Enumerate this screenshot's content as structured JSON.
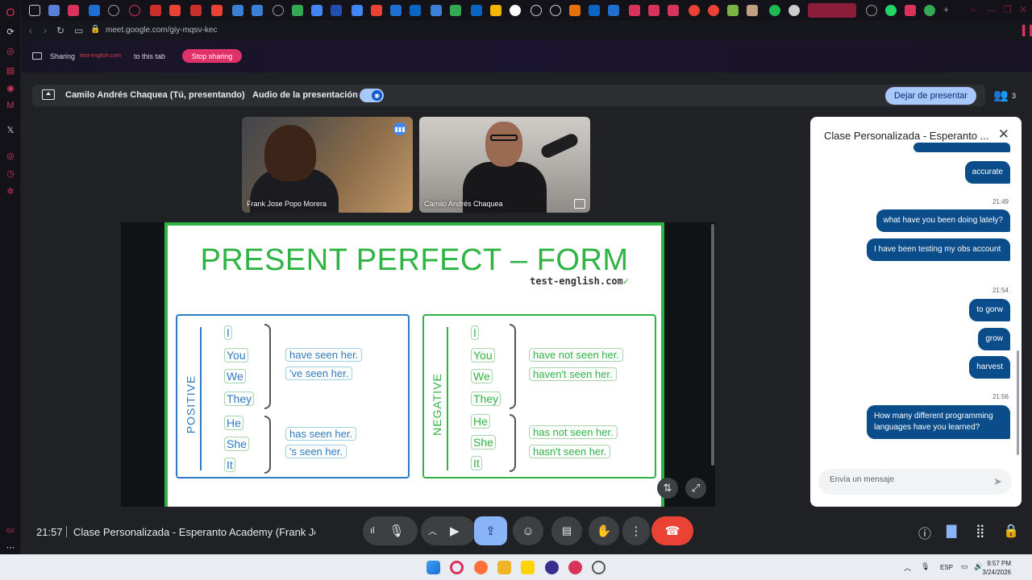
{
  "browser": {
    "url": "meet.google.com/giy-mqsv-kec"
  },
  "share_bar": {
    "sharing_label": "Sharing",
    "domain": "test-english.com",
    "to_tab": "to this tab",
    "stop_label": "Stop sharing"
  },
  "present_bar": {
    "presenter": "Camilo Andrés Chaquea (Tú, presentando)",
    "audio_label": "Audio de la presentación",
    "stop_presenting": "Dejar de presentar",
    "participant_count": "3"
  },
  "tiles": [
    {
      "name": "Frank Jose Popo Morera"
    },
    {
      "name": "Camilo Andrés Chaquea"
    }
  ],
  "slide": {
    "title": "PRESENT PERFECT – FORM",
    "brand": "test-english.com",
    "positive": {
      "label": "POSITIVE",
      "pronouns_a": [
        "I",
        "You",
        "We",
        "They"
      ],
      "pronouns_b": [
        "He",
        "She",
        "It"
      ],
      "verbs_a": [
        "have seen her.",
        "'ve seen her."
      ],
      "verbs_b": [
        "has seen her.",
        "'s seen her."
      ]
    },
    "negative": {
      "label": "NEGATIVE",
      "pronouns_a": [
        "I",
        "You",
        "We",
        "They"
      ],
      "pronouns_b": [
        "He",
        "She",
        "It"
      ],
      "verbs_a": [
        "have not seen her.",
        "haven't seen her."
      ],
      "verbs_b": [
        "has not seen her.",
        "hasn't seen her."
      ]
    },
    "accent_green": "#2fb343",
    "accent_blue": "#2f7ac0"
  },
  "chat": {
    "title": "Clase Personalizada - Esperanto ...",
    "messages": [
      {
        "time": "",
        "text": "accurate"
      },
      {
        "time": "21:49",
        "text": "what have you been doing lately?"
      },
      {
        "time": "",
        "text": "I have been testing my obs account"
      },
      {
        "time": "21:54",
        "text": "to gorw"
      },
      {
        "time": "",
        "text": "grow"
      },
      {
        "time": "",
        "text": "harvest"
      },
      {
        "time": "21:56",
        "text": "How many different programming languages have you learned?"
      }
    ],
    "input_placeholder": "Envía un mensaje",
    "bubble_color": "#0b4d8a"
  },
  "controls": {
    "clock": "21:57",
    "meeting_name": "Clase Personalizada - Esperanto Academy (Frank Jo..."
  },
  "taskbar": {
    "lang": "ESP",
    "time": "9:57 PM",
    "date": "3/24/2026"
  }
}
